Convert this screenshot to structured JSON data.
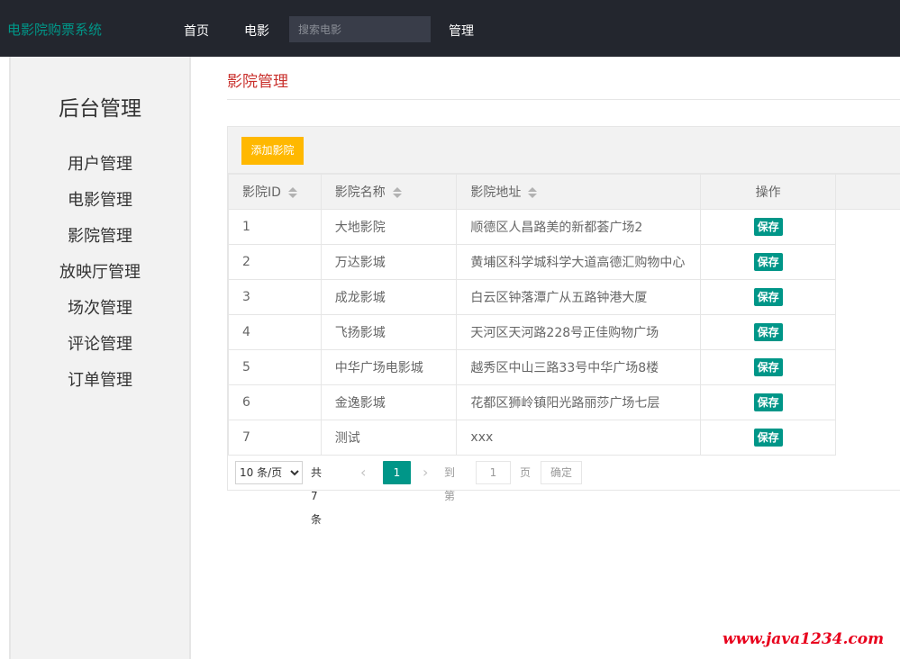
{
  "header": {
    "brand": "电影院购票系统",
    "nav": [
      "首页",
      "电影"
    ],
    "search_placeholder": "搜索电影",
    "nav_admin": "管理"
  },
  "sidebar": {
    "title": "后台管理",
    "items": [
      "用户管理",
      "电影管理",
      "影院管理",
      "放映厅管理",
      "场次管理",
      "评论管理",
      "订单管理"
    ]
  },
  "main": {
    "title": "影院管理",
    "add_button": "添加影院",
    "columns": [
      "影院ID",
      "影院名称",
      "影院地址",
      "操作"
    ],
    "rows": [
      {
        "id": "1",
        "name": "大地影院",
        "address": "顺德区人昌路美的新都荟广场2",
        "action": "保存"
      },
      {
        "id": "2",
        "name": "万达影城",
        "address": "黄埔区科学城科学大道高德汇购物中心",
        "action": "保存"
      },
      {
        "id": "3",
        "name": "成龙影城",
        "address": "白云区钟落潭广从五路钟港大厦",
        "action": "保存"
      },
      {
        "id": "4",
        "name": "飞扬影城",
        "address": "天河区天河路228号正佳购物广场",
        "action": "保存"
      },
      {
        "id": "5",
        "name": "中华广场电影城",
        "address": "越秀区中山三路33号中华广场8楼",
        "action": "保存"
      },
      {
        "id": "6",
        "name": "金逸影城",
        "address": "花都区狮岭镇阳光路丽莎广场七层",
        "action": "保存"
      },
      {
        "id": "7",
        "name": "测试",
        "address": "xxx",
        "action": "保存"
      }
    ],
    "pager": {
      "limit": "10 条/页",
      "total": "共 7 条",
      "current_page": "1",
      "goto_label": "到第",
      "goto_value": "1",
      "page_unit": "页",
      "confirm": "确定"
    }
  },
  "watermark": "www.java1234.com",
  "colors": {
    "accent": "#009688",
    "add_button": "#ffb800",
    "header_bg": "#23262e",
    "title": "#c9302c"
  }
}
